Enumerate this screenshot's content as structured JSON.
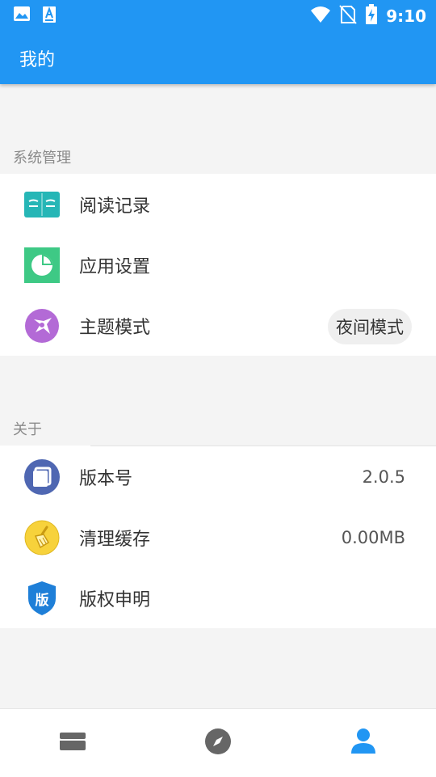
{
  "status_bar": {
    "time": "9:10",
    "left_icons": [
      "image-icon",
      "text-a-icon"
    ],
    "right_icons": [
      "wifi-icon",
      "no-sim-icon",
      "battery-charging-icon"
    ]
  },
  "header": {
    "title": "我的"
  },
  "sections": {
    "system": {
      "label": "系统管理",
      "items": [
        {
          "label": "阅读记录",
          "icon": "book-icon",
          "icon_color": "#26b6b6"
        },
        {
          "label": "应用设置",
          "icon": "pie-chart-icon",
          "icon_color": "#3ec985"
        },
        {
          "label": "主题模式",
          "icon": "theme-icon",
          "icon_color": "#b36ad6",
          "chip": "夜间模式"
        }
      ]
    },
    "about": {
      "label": "关于",
      "items": [
        {
          "label": "版本号",
          "icon": "version-icon",
          "icon_color": "#4f67b2",
          "value": "2.0.5"
        },
        {
          "label": "清理缓存",
          "icon": "broom-icon",
          "icon_color": "#f7d23b",
          "value": "0.00MB"
        },
        {
          "label": "版权申明",
          "icon": "copyright-shield-icon",
          "icon_color": "#1e7fd8",
          "badge_text": "版"
        }
      ]
    }
  },
  "bottom_nav": [
    {
      "icon": "shelf-icon",
      "active": false
    },
    {
      "icon": "compass-icon",
      "active": false
    },
    {
      "icon": "person-icon",
      "active": true
    }
  ],
  "colors": {
    "primary": "#2196f3",
    "inactive": "#666666"
  }
}
